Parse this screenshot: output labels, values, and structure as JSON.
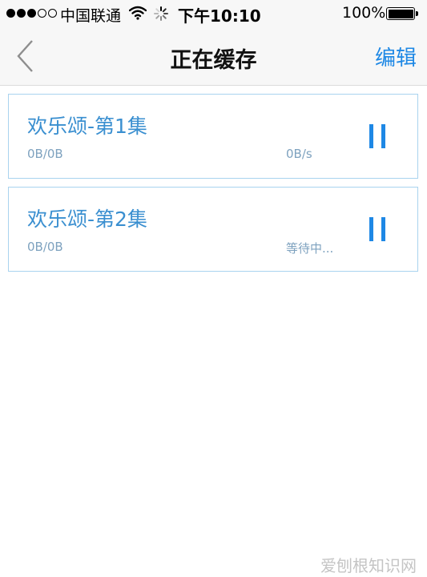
{
  "status_bar": {
    "carrier": "中国联通",
    "time": "下午10:10",
    "battery_percent": "100%",
    "signal_strength": 3,
    "icons": [
      "wifi-icon",
      "loading-spinner-icon",
      "battery-icon"
    ]
  },
  "nav": {
    "back_icon": "chevron-left-icon",
    "title": "正在缓存",
    "edit_label": "编辑"
  },
  "downloads": [
    {
      "title": "欢乐颂-第1集",
      "size": "0B/0B",
      "status": "0B/s",
      "action_icon": "pause-icon"
    },
    {
      "title": "欢乐颂-第2集",
      "size": "0B/0B",
      "status": "等待中...",
      "action_icon": "pause-icon"
    }
  ],
  "watermark": "爱刨根知识网",
  "colors": {
    "accent": "#1e88e5",
    "item_title": "#3a8fd0",
    "item_meta": "#7ea2bf",
    "item_border": "#a9d3ef",
    "bar_background": "#f7f7f7"
  }
}
